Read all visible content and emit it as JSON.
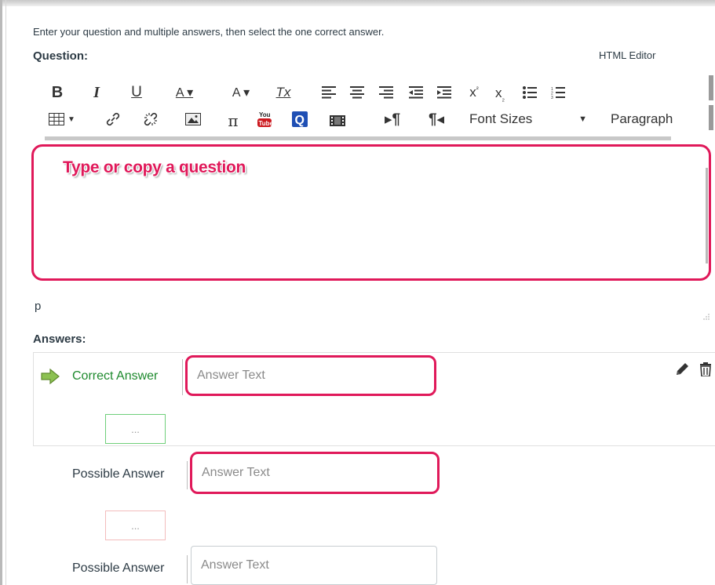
{
  "instructions": "Enter your question and multiple answers, then select the one correct answer.",
  "question_label": "Question:",
  "html_editor_link": "HTML Editor",
  "toolbar": {
    "row1": [
      "B",
      "I",
      "U",
      "A ▾",
      "A ▾",
      "Tx"
    ],
    "font_sizes": "Font Sizes",
    "paragraph": "Paragraph"
  },
  "question_text": "Type or copy a question",
  "path_indicator": "p",
  "answers_label": "Answers:",
  "answers": [
    {
      "label": "Correct Answer",
      "placeholder": "Answer Text",
      "comment_placeholder": "..."
    },
    {
      "label": "Possible Answer",
      "placeholder": "Answer Text",
      "comment_placeholder": "..."
    },
    {
      "label": "Possible Answer",
      "placeholder": "Answer Text"
    }
  ],
  "colors": {
    "highlight": "#e0195a",
    "correct_green": "#1e8a2e",
    "arrow_green": "#8cc152"
  }
}
